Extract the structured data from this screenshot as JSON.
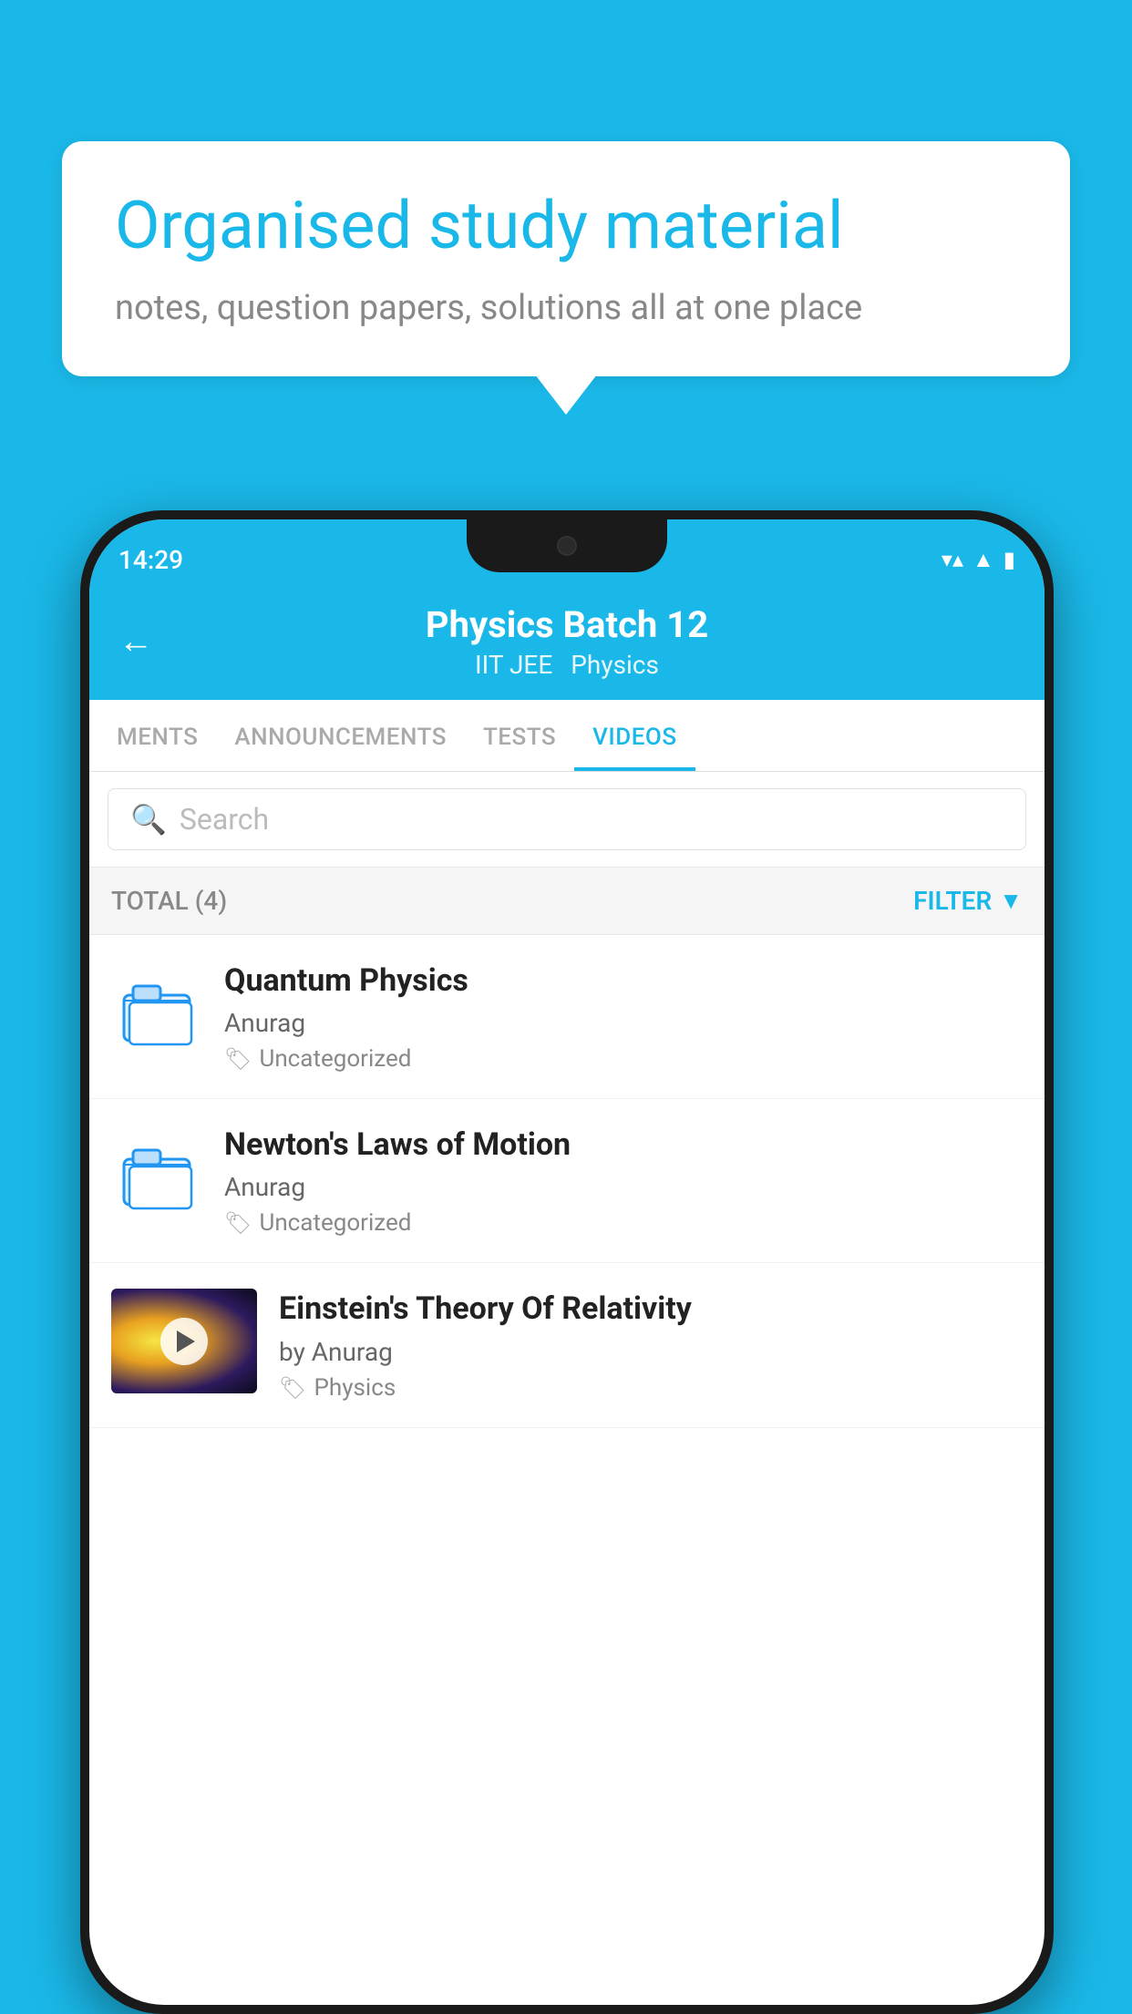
{
  "background": {
    "color": "#1ab8e8"
  },
  "speech_bubble": {
    "title": "Organised study material",
    "subtitle": "notes, question papers, solutions all at one place"
  },
  "phone": {
    "status_bar": {
      "time": "14:29",
      "icons": [
        "wifi",
        "signal",
        "battery"
      ]
    },
    "header": {
      "back_label": "←",
      "title": "Physics Batch 12",
      "subtitle_parts": [
        "IIT JEE",
        "Physics"
      ]
    },
    "tabs": [
      {
        "label": "MENTS",
        "active": false
      },
      {
        "label": "ANNOUNCEMENTS",
        "active": false
      },
      {
        "label": "TESTS",
        "active": false
      },
      {
        "label": "VIDEOS",
        "active": true
      }
    ],
    "search": {
      "placeholder": "Search"
    },
    "filter_bar": {
      "total_label": "TOTAL (4)",
      "filter_label": "FILTER"
    },
    "videos": [
      {
        "id": 1,
        "title": "Quantum Physics",
        "author": "Anurag",
        "tag": "Uncategorized",
        "has_thumbnail": false
      },
      {
        "id": 2,
        "title": "Newton's Laws of Motion",
        "author": "Anurag",
        "tag": "Uncategorized",
        "has_thumbnail": false
      },
      {
        "id": 3,
        "title": "Einstein's Theory Of Relativity",
        "author": "by Anurag",
        "tag": "Physics",
        "has_thumbnail": true
      }
    ]
  }
}
